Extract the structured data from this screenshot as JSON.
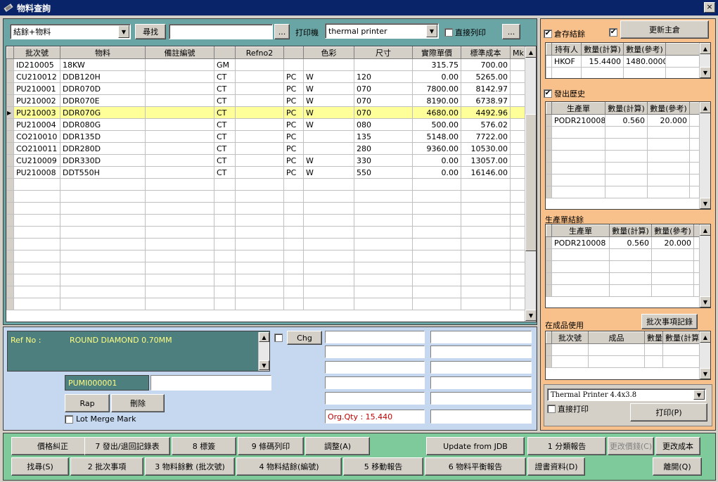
{
  "window": {
    "title": "物料查詢",
    "close": "×"
  },
  "toolbar": {
    "filter_value": "結餘+物料",
    "search_label": "尋找",
    "search_value": "",
    "browse_label": "...",
    "printer_label": "打印機",
    "printer_value": "thermal printer",
    "direct_print_label": "直接列印",
    "printer_browse_label": "..."
  },
  "main_table": {
    "headers": [
      "批次號",
      "物料",
      "備註編號",
      "",
      "Refno2",
      "",
      "色彩",
      "尺寸",
      "實際單價",
      "標準成本",
      "Mk"
    ],
    "rows": [
      [
        "ID210005",
        "18KW",
        "",
        "GM",
        "",
        "",
        "",
        "",
        "315.75",
        "700.00",
        ""
      ],
      [
        "CU210012",
        "DDB120H",
        "",
        "CT",
        "",
        "PC",
        "W",
        "120",
        "0.00",
        "5265.00",
        ""
      ],
      [
        "PU210001",
        "DDR070D",
        "",
        "CT",
        "",
        "PC",
        "W",
        "070",
        "7800.00",
        "8142.97",
        ""
      ],
      [
        "PU210002",
        "DDR070E",
        "",
        "CT",
        "",
        "PC",
        "W",
        "070",
        "8190.00",
        "6738.97",
        ""
      ],
      [
        "PU210003",
        "DDR070G",
        "",
        "CT",
        "",
        "PC",
        "W",
        "070",
        "4680.00",
        "4492.96",
        ""
      ],
      [
        "PU210004",
        "DDR080G",
        "",
        "CT",
        "",
        "PC",
        "W",
        "080",
        "500.00",
        "576.02",
        ""
      ],
      [
        "CO210010",
        "DDR135D",
        "",
        "CT",
        "",
        "PC",
        "",
        "135",
        "5148.00",
        "7722.00",
        ""
      ],
      [
        "CO210011",
        "DDR280D",
        "",
        "CT",
        "",
        "PC",
        "",
        "280",
        "9360.00",
        "10530.00",
        ""
      ],
      [
        "CU210009",
        "DDR330D",
        "",
        "CT",
        "",
        "PC",
        "W",
        "330",
        "0.00",
        "13057.00",
        ""
      ],
      [
        "PU210008",
        "DDT550H",
        "",
        "CT",
        "",
        "PC",
        "W",
        "550",
        "0.00",
        "16146.00",
        ""
      ]
    ],
    "selected_row": 4
  },
  "detail": {
    "ref_label": "Ref No :",
    "ref_value": "ROUND DIAMOND 0.70MM",
    "chg_label": "Chg",
    "pumi_value": "PUMI000001",
    "rap_label": "Rap",
    "delete_label": "刪除",
    "lot_merge_label": "Lot Merge Mark",
    "org_qty": "Org.Qty : 15.440"
  },
  "right_panel": {
    "stock_label": "倉存結餘",
    "update_label": "更新主倉",
    "stock_headers": [
      "持有人",
      "數量(計算)",
      "數量(參考)"
    ],
    "stock_rows": [
      [
        "HKOF",
        "15.4400",
        "1480.0000"
      ]
    ],
    "history_label": "發出歷史",
    "history_headers": [
      "生產單",
      "數量(計算)",
      "數量(參考)"
    ],
    "history_rows": [
      [
        "PODR210008",
        "0.560",
        "20.000"
      ]
    ],
    "prod_label": "生產單結餘",
    "prod_headers": [
      "生產單",
      "數量(計算)",
      "數量(參考)"
    ],
    "prod_rows": [
      [
        "PODR210008",
        "0.560",
        "20.000"
      ]
    ],
    "wip_label": "在成品使用",
    "batch_record_label": "批次事項記錄",
    "wip_headers": [
      "批次號",
      "成品",
      "數量",
      "數量(計算)"
    ],
    "print_format": "Thermal Printer 4.4x3.8",
    "direct_print_label": "直接打印",
    "print_label": "打印(P)"
  },
  "bottom": {
    "row1": [
      "價格糾正",
      "7 發出/退回記錄表",
      "8 標簽",
      "9 條碼列印",
      "調整(A)",
      "Update from JDB",
      "1 分類報告",
      "更改價錢(C)",
      "更改成本"
    ],
    "row2": [
      "找尋(S)",
      "2 批次事項",
      "3 物料餘數 (批次號)",
      "4 物料結餘(編號)",
      "5 移動報告",
      "6 物料平衡報告",
      "證書資料(D)",
      "離開(Q)"
    ]
  },
  "colors": {
    "title_bg": "#0a246a",
    "teal": "#6aa5a5",
    "orange": "#f8c08a",
    "green": "#7fca9a",
    "blue": "#c5d8f0",
    "highlight": "#ffff99"
  }
}
